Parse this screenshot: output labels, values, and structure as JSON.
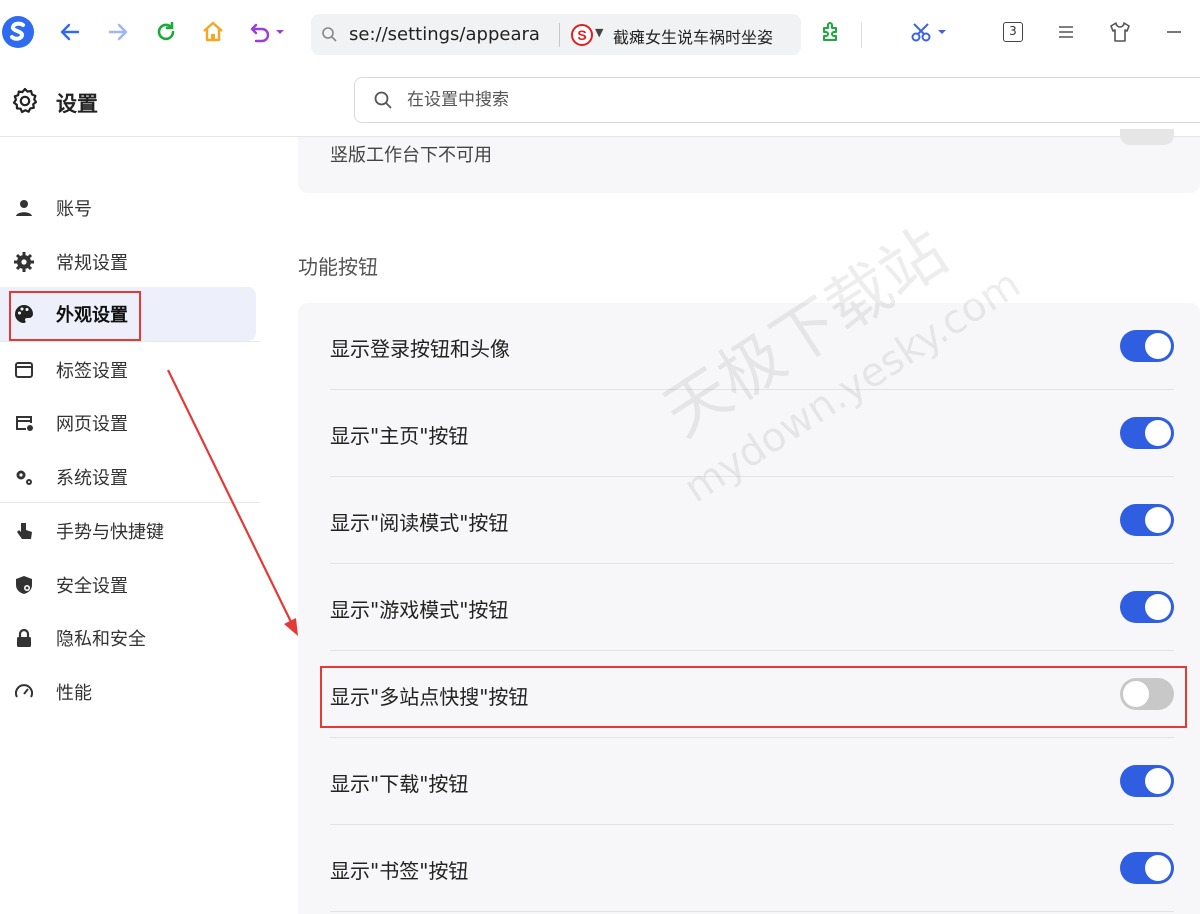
{
  "browser": {
    "address_url": "se://settings/appeara",
    "hot_search": "截瘫女生说车祸时坐姿",
    "tab_count": "3"
  },
  "settings": {
    "title": "设置",
    "search_placeholder": "在设置中搜索"
  },
  "sidebar": {
    "items": [
      {
        "label": "账号"
      },
      {
        "label": "常规设置"
      },
      {
        "label": "外观设置"
      },
      {
        "label": "标签设置"
      },
      {
        "label": "网页设置"
      },
      {
        "label": "系统设置"
      },
      {
        "label": "手势与快捷键"
      },
      {
        "label": "安全设置"
      },
      {
        "label": "隐私和安全"
      },
      {
        "label": "性能"
      }
    ]
  },
  "main": {
    "top_note": "竖版工作台下不可用",
    "section_title": "功能按钮",
    "rows": [
      {
        "label": "显示登录按钮和头像",
        "enabled": true
      },
      {
        "label": "显示\"主页\"按钮",
        "enabled": true
      },
      {
        "label": "显示\"阅读模式\"按钮",
        "enabled": true
      },
      {
        "label": "显示\"游戏模式\"按钮",
        "enabled": true
      },
      {
        "label": "显示\"多站点快搜\"按钮",
        "enabled": false
      },
      {
        "label": "显示\"下载\"按钮",
        "enabled": true
      },
      {
        "label": "显示\"书签\"按钮",
        "enabled": true
      }
    ]
  },
  "watermark": {
    "line1": "天极下载站",
    "line2": "mydown.yesky.com"
  },
  "colors": {
    "accent": "#2f5fe0",
    "annotation": "#e53935",
    "toggle_off": "#c8c8c8"
  }
}
